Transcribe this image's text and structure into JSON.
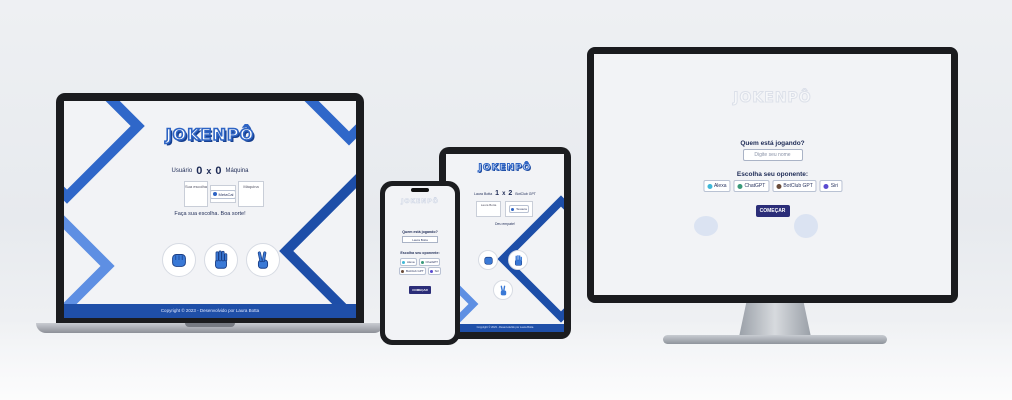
{
  "app": {
    "logo": "JOKENPÔ",
    "user_label": "Usuário",
    "machine_label": "Máquina",
    "score_separator": "x",
    "start_button": "COMEÇAR",
    "footer": "Copyright © 2023 - Desenvolvido por Laura Botta"
  },
  "laptop": {
    "user_score": "0",
    "machine_score": "0",
    "your_choice": "Sua escolha",
    "opponent_tag": "MetaCal",
    "machine_box": "Máquina",
    "prompt": "Faça sua escolha. Boa sorte!"
  },
  "tablet": {
    "user_name": "Laura Botta",
    "user_score": "1",
    "machine_score": "2",
    "opponent_name": "BotClub GPT",
    "left_box": "Laura Botta",
    "right_tag": "Tesoura",
    "result": "Deu empate!"
  },
  "phone": {
    "who_label": "Quem está jogando?",
    "name_value": "Laura Botta",
    "opponent_label": "Escolha seu oponente:",
    "opponents": [
      "Alexa",
      "ChatGPT",
      "BotClub GPT",
      "Siri"
    ]
  },
  "monitor": {
    "who_label": "Quem está jogando?",
    "name_placeholder": "Digite seu nome",
    "opponent_label": "Escolha seu oponente:",
    "opponents": [
      "Alexa",
      "ChatGPT",
      "BotClub GPT",
      "Siri"
    ]
  },
  "colors": {
    "brand_blue": "#2e64c4",
    "footer_blue": "#1f4fa8",
    "button_navy": "#2b2d78"
  },
  "icons": [
    "rock-hand-icon",
    "paper-hand-icon",
    "scissors-hand-icon",
    "opponent-avatar-icon"
  ]
}
